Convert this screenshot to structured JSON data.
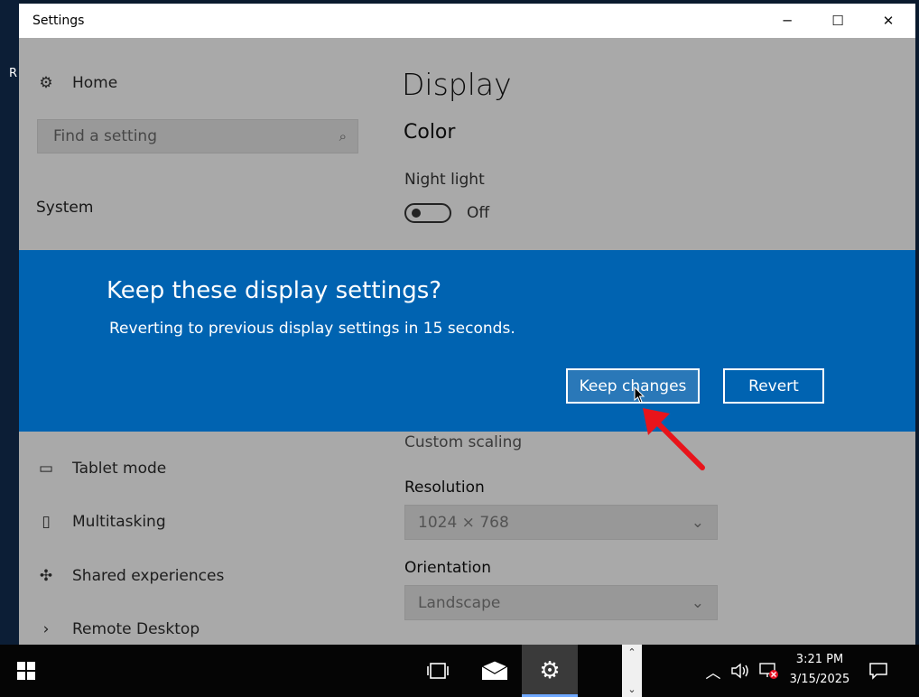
{
  "desktop": {
    "edge_text": "R"
  },
  "window": {
    "title": "Settings",
    "controls": {
      "minimize": "─",
      "maximize": "☐",
      "close": "✕"
    }
  },
  "sidebar": {
    "home_label": "Home",
    "search_placeholder": "Find a setting",
    "section_label": "System",
    "items": [
      {
        "label": "Tablet mode",
        "icon": "tablet-icon"
      },
      {
        "label": "Multitasking",
        "icon": "multitasking-icon"
      },
      {
        "label": "Shared experiences",
        "icon": "shared-experiences-icon"
      },
      {
        "label": "Remote Desktop",
        "icon": "remote-desktop-icon"
      }
    ]
  },
  "main": {
    "title": "Display",
    "color_heading": "Color",
    "night_light_label": "Night light",
    "night_light_state": "Off",
    "custom_scaling": "Custom scaling",
    "resolution_label": "Resolution",
    "resolution_value": "1024 × 768",
    "orientation_label": "Orientation",
    "orientation_value": "Landscape"
  },
  "dialog": {
    "title": "Keep these display settings?",
    "message": "Reverting to previous display settings in 15 seconds.",
    "keep_label": "Keep changes",
    "revert_label": "Revert"
  },
  "taskbar": {
    "time": "3:21 PM",
    "date": "3/15/2025"
  },
  "colors": {
    "dialog_bg": "#0063b1",
    "arrow": "#e8141b",
    "taskbar": "#050505"
  }
}
